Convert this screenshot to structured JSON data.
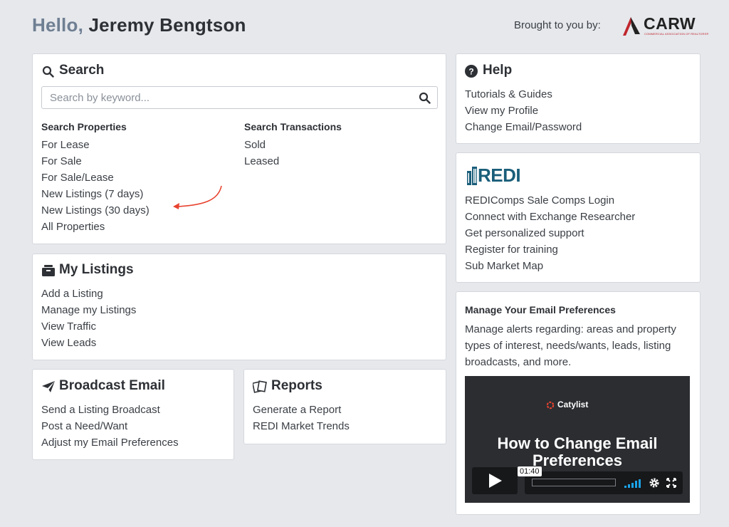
{
  "header": {
    "hello": "Hello,",
    "user_name": "Jeremy Bengtson",
    "brought_by": "Brought to you by:",
    "logo_text": "CARW",
    "logo_tagline": "COMMERCIAL ASSOCIATION OF REALTORS®"
  },
  "search": {
    "title": "Search",
    "placeholder": "Search by keyword...",
    "properties_heading": "Search Properties",
    "properties": [
      "For Lease",
      "For Sale",
      "For Sale/Lease",
      "New Listings (7 days)",
      "New Listings (30 days)",
      "All Properties"
    ],
    "transactions_heading": "Search Transactions",
    "transactions": [
      "Sold",
      "Leased"
    ]
  },
  "my_listings": {
    "title": "My Listings",
    "items": [
      "Add a Listing",
      "Manage my Listings",
      "View Traffic",
      "View Leads"
    ]
  },
  "broadcast": {
    "title": "Broadcast Email",
    "items": [
      "Send a Listing Broadcast",
      "Post a Need/Want",
      "Adjust my Email Preferences"
    ]
  },
  "reports": {
    "title": "Reports",
    "items": [
      "Generate a Report",
      "REDI Market Trends"
    ]
  },
  "help": {
    "title": "Help",
    "items": [
      "Tutorials & Guides",
      "View my Profile",
      "Change Email/Password"
    ]
  },
  "redi": {
    "logo_text": "REDI",
    "items": [
      "REDIComps Sale Comps Login",
      "Connect with Exchange Researcher",
      "Get personalized support",
      "Register for training",
      "Sub Market Map"
    ]
  },
  "email_prefs": {
    "title": "Manage Your Email Preferences",
    "description": "Manage alerts regarding: areas and property types of interest, needs/wants, leads, listing broadcasts, and more.",
    "video": {
      "brand": "Catylist",
      "title": "How to Change Email Preferences",
      "time": "01:40"
    }
  },
  "colors": {
    "accent_red": "#c0262d",
    "redi_teal": "#1a5e7a",
    "hello_slate": "#6f7f93"
  }
}
